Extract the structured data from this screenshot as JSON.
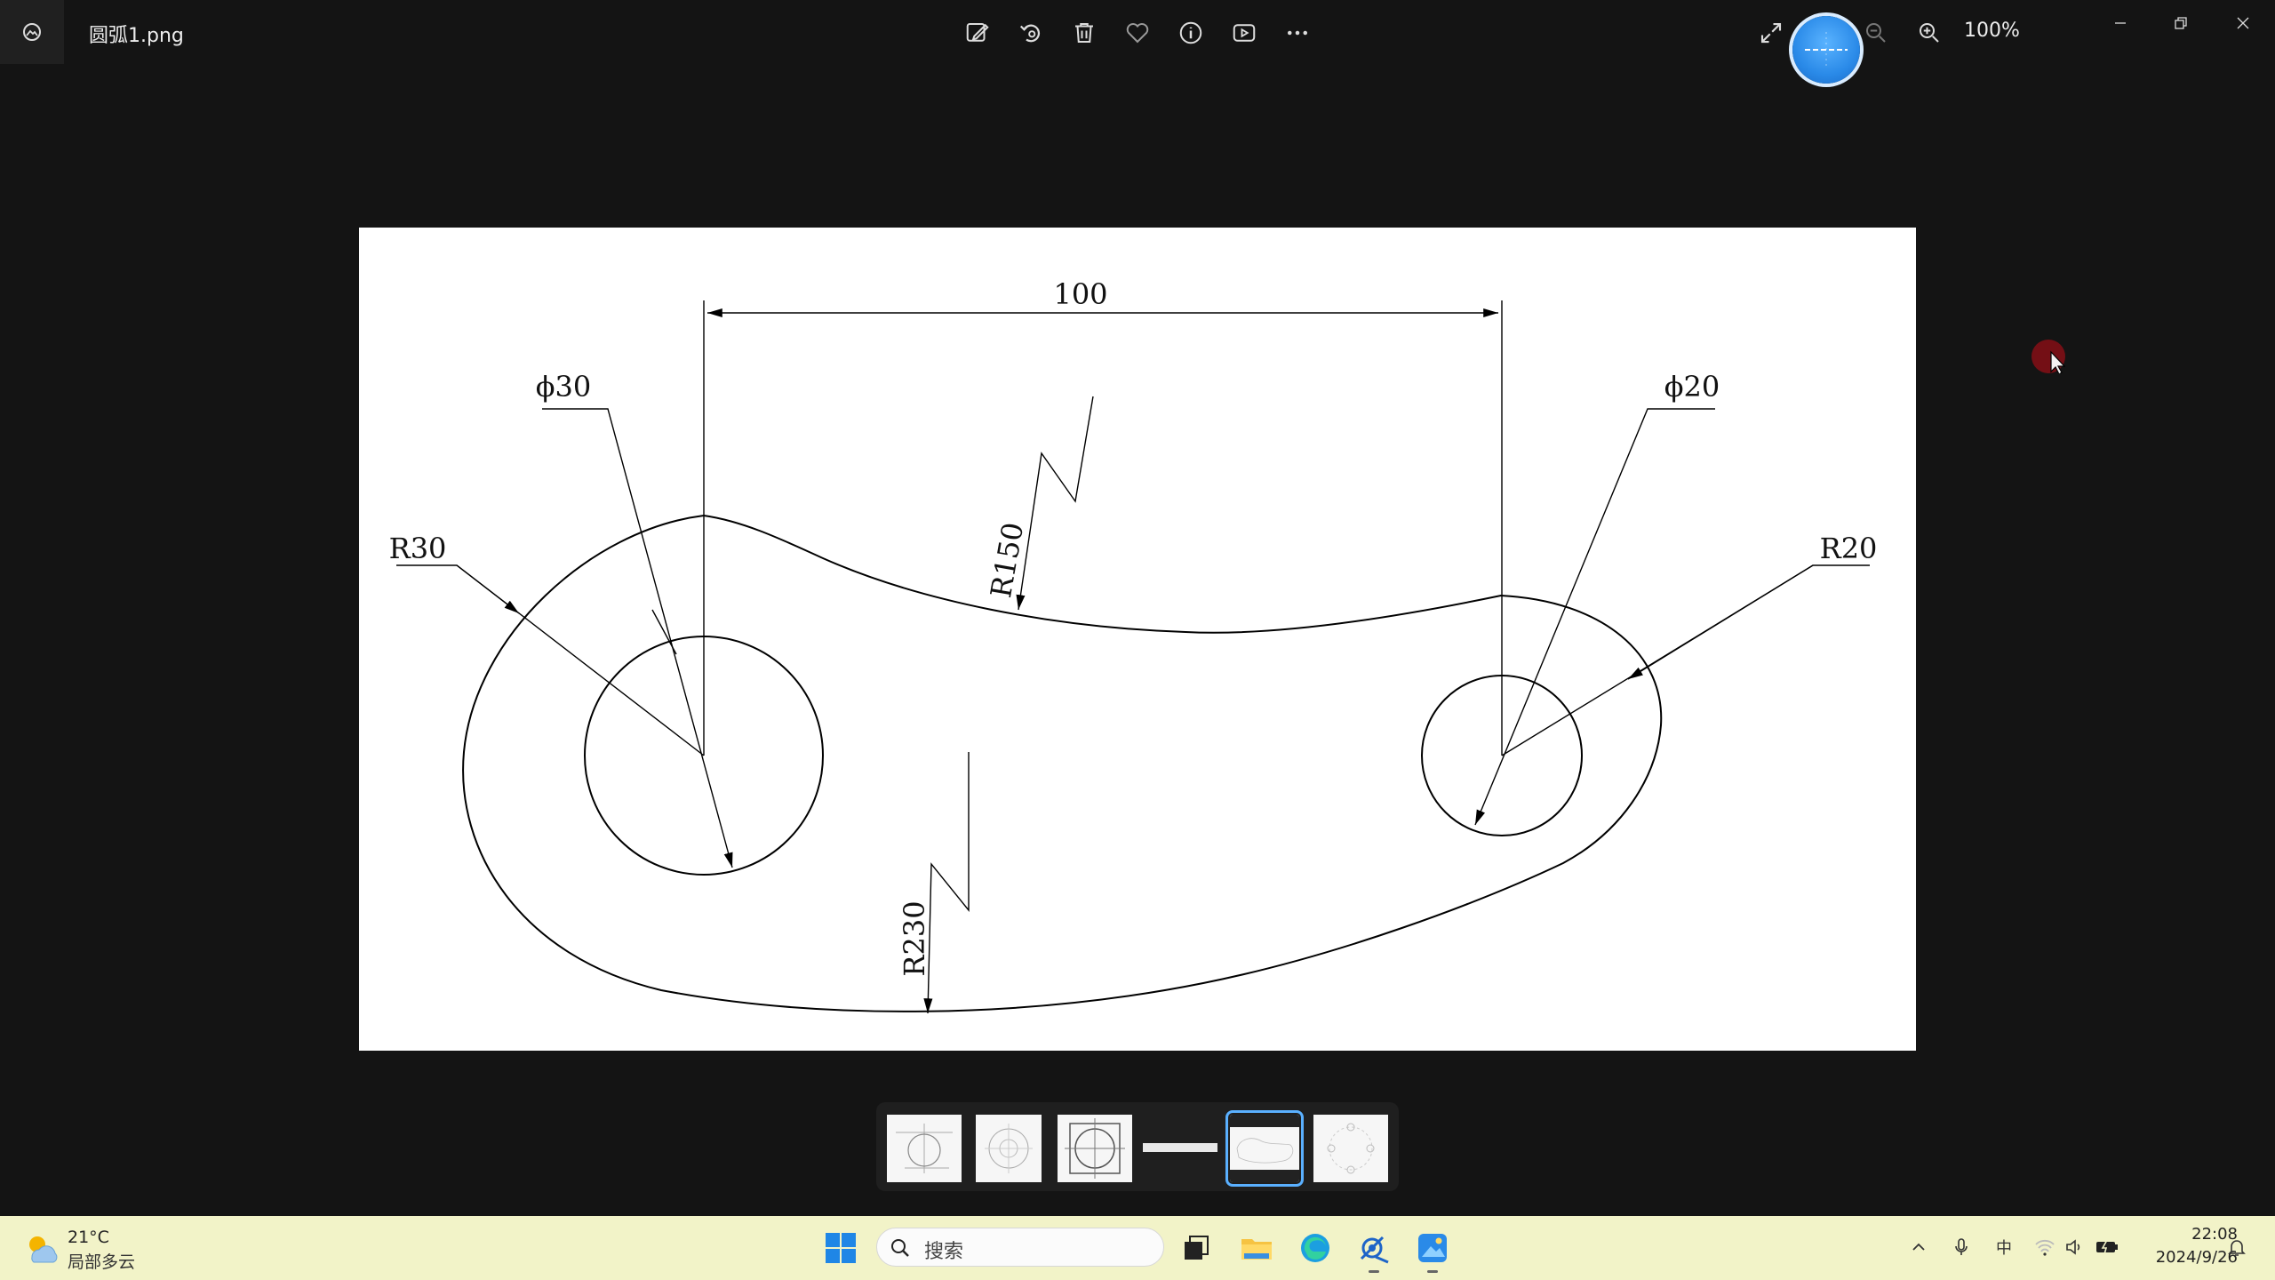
{
  "window": {
    "title": "圆弧1.png",
    "zoom": "100%"
  },
  "toolbar": {
    "items": [
      "edit-icon",
      "rotate-icon",
      "delete-icon",
      "favorite-icon",
      "info-icon",
      "slideshow-icon",
      "more-icon"
    ],
    "right_items": [
      "fullscreen-icon",
      "zoom-out-icon",
      "zoom-in-icon"
    ]
  },
  "drawing": {
    "dim_100": "100",
    "dim_phi30": "ϕ30",
    "dim_phi20": "ϕ20",
    "dim_r30": "R30",
    "dim_r20": "R20",
    "dim_r150": "R150",
    "dim_r230": "R230"
  },
  "filmstrip": {
    "count": 6,
    "selected_index": 4
  },
  "taskbar": {
    "weather_temp": "21°C",
    "weather_desc": "局部多云",
    "search_placeholder": "搜索",
    "time": "22:08",
    "date": "2024/9/26",
    "ime_label": "中",
    "colors": {
      "background": "#f2f3c8",
      "accent": "#2a8ae8"
    }
  }
}
